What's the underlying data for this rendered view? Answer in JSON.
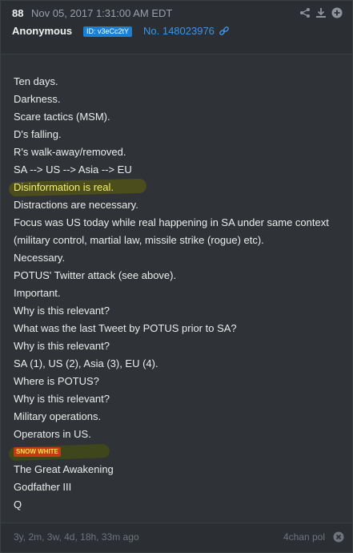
{
  "post": {
    "number": "88",
    "date": "Nov 05, 2017 1:31:00 AM EDT",
    "author": "Anonymous",
    "uid": "ID: v3eCc2tY",
    "post_no": "No. 148023976"
  },
  "header_icons": [
    "share-icon",
    "download-icon",
    "add-icon"
  ],
  "lines": [
    "Ten days.",
    "Darkness.",
    "Scare tactics (MSM).",
    "D's falling.",
    "R's walk-away/removed.",
    "SA --> US --> Asia --> EU",
    "Disinformation is real.",
    "Distractions are necessary.",
    "Focus was US today while real happening in SA under same context",
    "(military control, martial law, missile strike (rogue) etc).",
    "Necessary.",
    "POTUS' Twitter attack (see above).",
    "Important.",
    "Why is this relevant?",
    "What was the last Tweet by POTUS prior to SA?",
    "Why is this relevant?",
    "SA (1), US (2), Asia (3), EU (4).",
    "Where is POTUS?",
    "Why is this relevant?",
    "Military operations.",
    "Operators in US.",
    "SNOW WHITE",
    "The Great Awakening",
    "Godfather III",
    "Q"
  ],
  "colors": {
    "highlight_text": "#f2ef6a",
    "badge_bg": "#c43a16",
    "badge_text": "#f7e04b",
    "link": "#3a95e8"
  },
  "footer": {
    "ago": "3y, 2m, 3w, 4d, 18h, 33m ago",
    "source": "4chan pol"
  }
}
